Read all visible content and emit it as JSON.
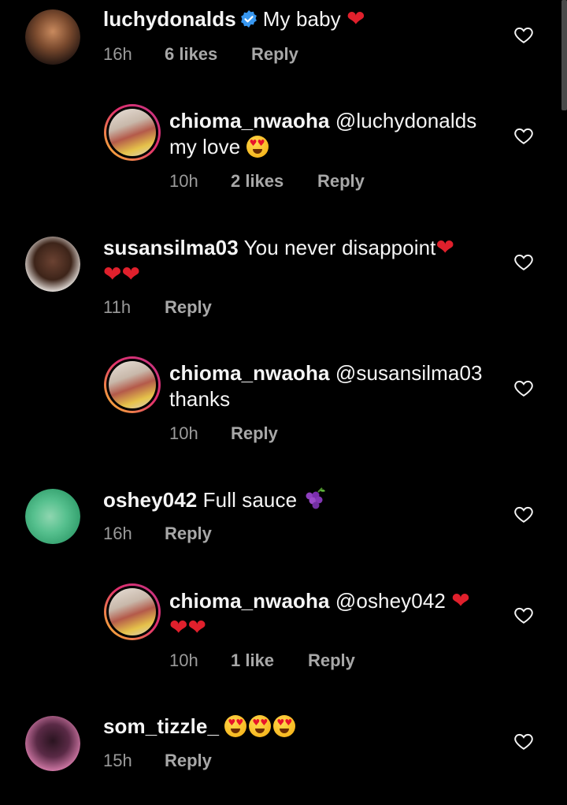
{
  "comments": [
    {
      "username": "luchydonalds",
      "verified": true,
      "text": "My baby",
      "emoji": "❤",
      "time": "16h",
      "likes": "6 likes",
      "reply": "Reply"
    },
    {
      "username": "chioma_nwaoha",
      "mention": "@luchydonalds",
      "text": "my love",
      "emoji": "love-eyes-emoji",
      "time": "10h",
      "likes": "2 likes",
      "reply": "Reply"
    },
    {
      "username": "susansilma03",
      "text": "You never disappoint",
      "emoji": "❤",
      "emoji_line2": "❤❤",
      "time": "11h",
      "reply": "Reply"
    },
    {
      "username": "chioma_nwaoha",
      "mention": "@susansilma03",
      "text": "thanks",
      "time": "10h",
      "reply": "Reply"
    },
    {
      "username": "oshey042",
      "text": "Full sauce",
      "emoji": "grapes-emoji",
      "time": "16h",
      "reply": "Reply"
    },
    {
      "username": "chioma_nwaoha",
      "mention": "@oshey042",
      "emoji": "❤",
      "emoji_line2": "❤❤",
      "time": "10h",
      "likes": "1 like",
      "reply": "Reply"
    },
    {
      "username": "som_tizzle_",
      "emoji": "love-eyes-emoji x3",
      "time": "15h",
      "reply": "Reply"
    }
  ],
  "colors": {
    "background": "#000000",
    "text": "#f5f5f5",
    "meta": "#a8a8a8",
    "heart": "#e0202c",
    "verified": "#3897f0"
  }
}
